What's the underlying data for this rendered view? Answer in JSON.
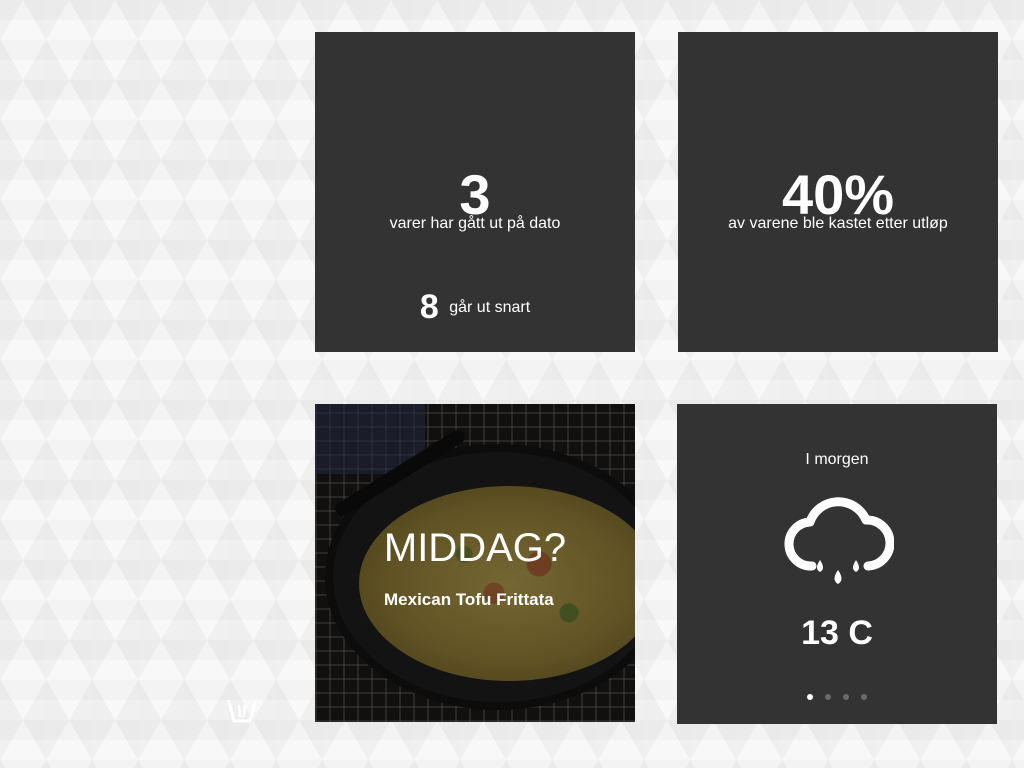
{
  "tiles": {
    "expired": {
      "count": "3",
      "caption": "varer har gått ut på dato",
      "soon_count": "8",
      "soon_label": "går ut snart"
    },
    "waste": {
      "percent": "40%",
      "caption": "av varene ble kastet etter utløp"
    },
    "dinner": {
      "headline": "MIDDAG?",
      "recipe": "Mexican Tofu Frittata"
    },
    "weather": {
      "when": "I morgen",
      "icon": "rain-cloud-icon",
      "temperature": "13 C",
      "page_index": 0.25
    }
  },
  "carousel": {
    "dots": [
      "page-1",
      "page-2",
      "page-3",
      "page-4"
    ],
    "active": "page-1"
  },
  "logo": {
    "icon": "trash-can-icon"
  },
  "colors": {
    "tile_background": "#333333",
    "text": "#ffffff",
    "page_background": "#f3f3f3"
  }
}
